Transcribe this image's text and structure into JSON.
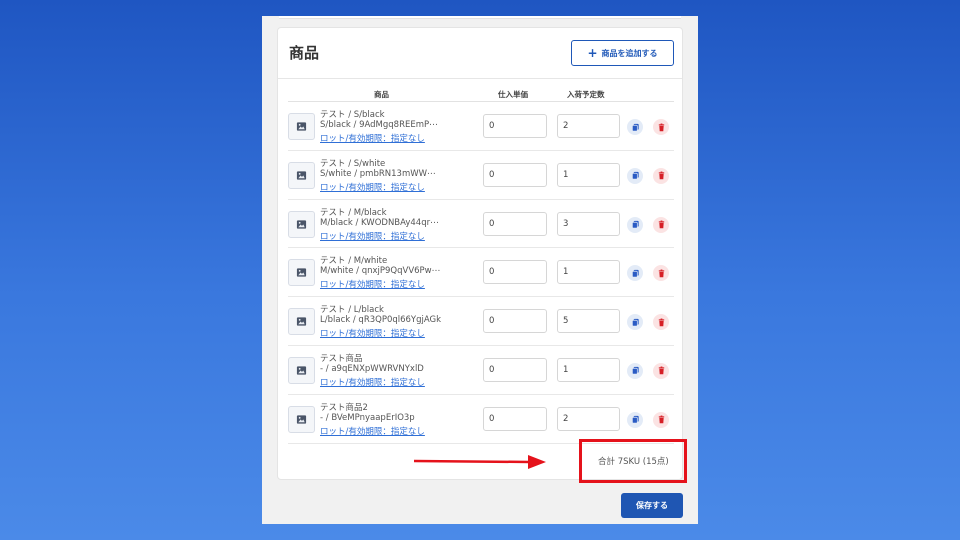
{
  "card": {
    "title": "商品",
    "add_button_label": "商品を追加する"
  },
  "table": {
    "headers": [
      "商品",
      "仕入単価",
      "入荷予定数"
    ],
    "rows": [
      {
        "name": "テスト / S/black",
        "variant": "S/black / 9AdMgq8REEmP⋯",
        "lot_link": "ロット/有効期限：指定なし",
        "unit_price": "0",
        "quantity": "2"
      },
      {
        "name": "テスト / S/white",
        "variant": "S/white / pmbRN13mWW⋯",
        "lot_link": "ロット/有効期限：指定なし",
        "unit_price": "0",
        "quantity": "1"
      },
      {
        "name": "テスト / M/black",
        "variant": "M/black / KWODNBAy44qr⋯",
        "lot_link": "ロット/有効期限：指定なし",
        "unit_price": "0",
        "quantity": "3"
      },
      {
        "name": "テスト / M/white",
        "variant": "M/white / qnxjP9QqVV6Pw⋯",
        "lot_link": "ロット/有効期限：指定なし",
        "unit_price": "0",
        "quantity": "1"
      },
      {
        "name": "テスト / L/black",
        "variant": "L/black / qR3QP0ql66YgjAGk",
        "lot_link": "ロット/有効期限：指定なし",
        "unit_price": "0",
        "quantity": "5"
      },
      {
        "name": "テスト商品",
        "variant": "- / a9qENXpWWRVNYxlD",
        "lot_link": "ロット/有効期限：指定なし",
        "unit_price": "0",
        "quantity": "1"
      },
      {
        "name": "テスト商品2",
        "variant": "- / BVeMPnyaapErIO3p",
        "lot_link": "ロット/有効期限：指定なし",
        "unit_price": "0",
        "quantity": "2"
      }
    ]
  },
  "summary": {
    "total_text": "合計 7SKU (15点)"
  },
  "save_button_label": "保存する",
  "icons": {
    "thumbnail": "image-placeholder-icon",
    "copy": "copy-icon",
    "delete": "trash-icon",
    "add": "plus-icon"
  },
  "colors": {
    "primary": "#1f56b3",
    "link": "#2f6fd6",
    "danger": "#e5121b",
    "background": "#2c66d0"
  }
}
